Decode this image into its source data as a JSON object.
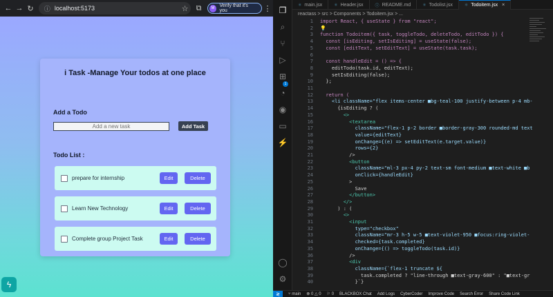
{
  "browser": {
    "url": "localhost:5173",
    "verify_label": "Verify that it's you",
    "verify_avatar": "M"
  },
  "app": {
    "title": "i Task -Manage Your todos at one place",
    "add_heading": "Add a Todo",
    "input_placeholder": "Add a new task",
    "add_button": "Add Task",
    "list_heading": "Todo List :",
    "edit_label": "Edit",
    "delete_label": "Delete",
    "todos": [
      {
        "text": "prepare for internship"
      },
      {
        "text": "Learn New Technology"
      },
      {
        "text": "Complete group Project Task"
      }
    ]
  },
  "vscode": {
    "tabs": [
      {
        "label": "main.jsx",
        "active": false
      },
      {
        "label": "Header.jsx",
        "active": false
      },
      {
        "label": "README.md",
        "active": false
      },
      {
        "label": "Todolist.jsx",
        "active": false
      },
      {
        "label": "Todoitem.jsx",
        "active": true
      }
    ],
    "breadcrumb": "reactass > src > Components > Todoitem.jsx > ...",
    "lines": [
      {
        "n": "1",
        "code": "import React, { useState } from \"react\";"
      },
      {
        "n": "2",
        "code": "💡"
      },
      {
        "n": "3",
        "code": "function Todoitem({ task, toggleTodo, deleteTodo, editTodo }) {"
      },
      {
        "n": "4",
        "code": "  const [isEditing, setIsEditing] = useState(false);"
      },
      {
        "n": "5",
        "code": "  const [editText, setEditText] = useState(task.task);"
      },
      {
        "n": "6",
        "code": ""
      },
      {
        "n": "7",
        "code": "  const handleEdit = () => {"
      },
      {
        "n": "8",
        "code": "    editTodo(task.id, editText);"
      },
      {
        "n": "9",
        "code": "    setIsEditing(false);"
      },
      {
        "n": "10",
        "code": "  };"
      },
      {
        "n": "11",
        "code": ""
      },
      {
        "n": "12",
        "code": "  return ("
      },
      {
        "n": "13",
        "code": "    <li className=\"flex items-center ■bg-teal-100 justify-between p-4 mb-"
      },
      {
        "n": "14",
        "code": "      {isEditing ? ("
      },
      {
        "n": "15",
        "code": "        <>"
      },
      {
        "n": "16",
        "code": "          <textarea"
      },
      {
        "n": "17",
        "code": "            className=\"flex-1 p-2 border ■border-gray-300 rounded-md text"
      },
      {
        "n": "18",
        "code": "            value={editText}"
      },
      {
        "n": "19",
        "code": "            onChange={(e) => setEditText(e.target.value)}"
      },
      {
        "n": "20",
        "code": "            rows={2}"
      },
      {
        "n": "21",
        "code": "          />"
      },
      {
        "n": "22",
        "code": "          <button"
      },
      {
        "n": "23",
        "code": "            className=\"ml-3 px-4 py-2 text-sm font-medium ■text-white ■b"
      },
      {
        "n": "24",
        "code": "            onClick={handleEdit}"
      },
      {
        "n": "25",
        "code": "          >"
      },
      {
        "n": "26",
        "code": "            Save"
      },
      {
        "n": "27",
        "code": "          </button>"
      },
      {
        "n": "28",
        "code": "        </>"
      },
      {
        "n": "29",
        "code": "      ) : ("
      },
      {
        "n": "30",
        "code": "        <>"
      },
      {
        "n": "31",
        "code": "          <input"
      },
      {
        "n": "32",
        "code": "            type=\"checkbox\""
      },
      {
        "n": "33",
        "code": "            className=\"mr-3 h-5 w-5 ■text-violet-950 ■focus:ring-violet-"
      },
      {
        "n": "34",
        "code": "            checked={task.completed}"
      },
      {
        "n": "35",
        "code": "            onChange={() => toggleTodo(task.id)}"
      },
      {
        "n": "36",
        "code": "          />"
      },
      {
        "n": "37",
        "code": "          <div"
      },
      {
        "n": "38",
        "code": "            className={`flex-1 truncate ${"
      },
      {
        "n": "39",
        "code": "              task.completed ? \"line-through ■text-gray-600\" : \"■text-gr"
      },
      {
        "n": "40",
        "code": "            }`}"
      }
    ],
    "status": {
      "branch": "main",
      "errors": "0",
      "warnings": "0",
      "ports": "0",
      "items": [
        "BLACKBOX Chat",
        "Add Logs",
        "CyberCoder",
        "Improve Code",
        "Search Error",
        "Share Code Link"
      ]
    }
  }
}
